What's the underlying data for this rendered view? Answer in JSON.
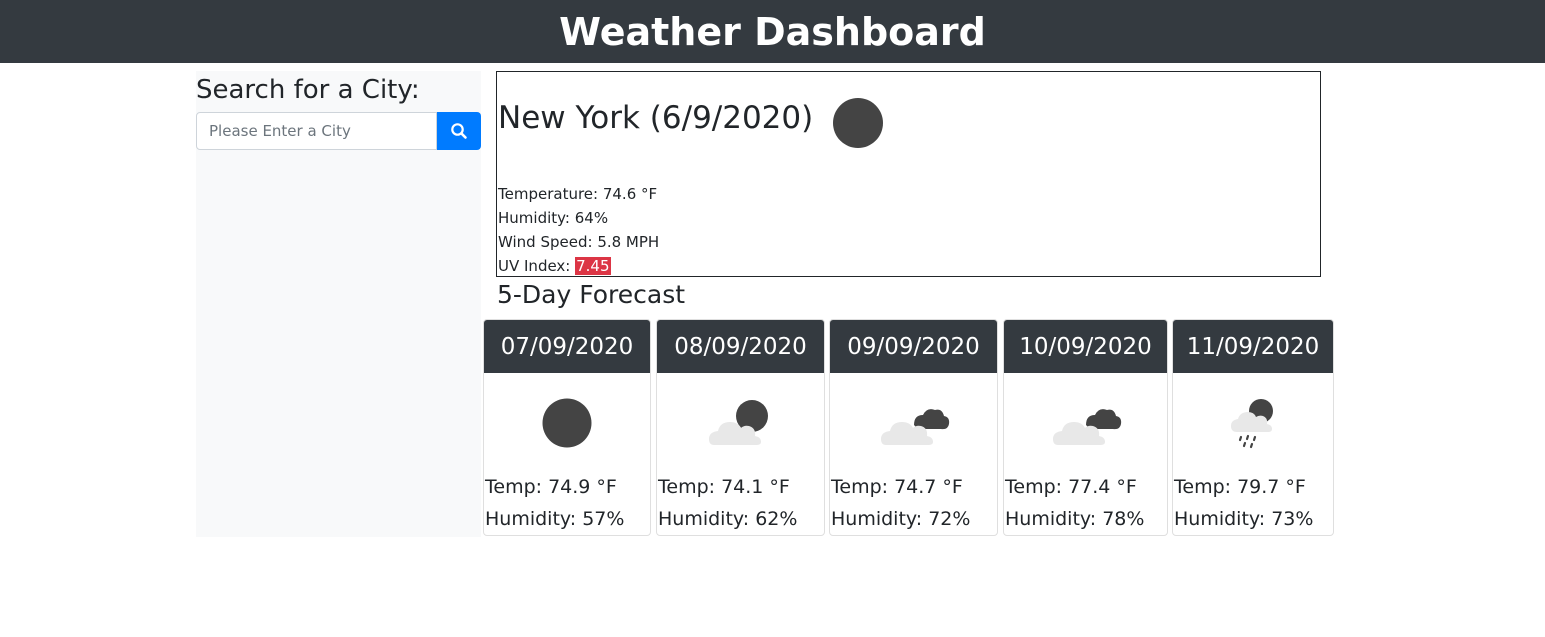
{
  "header": {
    "title": "Weather Dashboard"
  },
  "search": {
    "heading": "Search for a City:",
    "placeholder": "Please Enter a City",
    "value": "",
    "button_icon": "search-icon",
    "button_color": "#007bff"
  },
  "current": {
    "title": "New York (6/9/2020)",
    "icon": "clear-sun-icon",
    "temperature_label": "Temperature: ",
    "temperature": "74.6 °F",
    "humidity_label": "Humidity: ",
    "humidity": "64%",
    "wind_label": "Wind Speed: ",
    "wind": "5.8 MPH",
    "uv_label": "UV Index: ",
    "uv": "7.45",
    "uv_color": "#dc3545"
  },
  "forecast": {
    "title": "5-Day Forecast",
    "days": [
      {
        "date": "07/09/2020",
        "icon": "clear-sun-icon",
        "temp": "Temp: 74.9 °F",
        "humidity": "Humidity: 57%"
      },
      {
        "date": "08/09/2020",
        "icon": "partly-cloudy-icon",
        "temp": "Temp: 74.1 °F",
        "humidity": "Humidity: 62%"
      },
      {
        "date": "09/09/2020",
        "icon": "broken-clouds-icon",
        "temp": "Temp: 74.7 °F",
        "humidity": "Humidity: 72%"
      },
      {
        "date": "10/09/2020",
        "icon": "broken-clouds-icon",
        "temp": "Temp: 77.4 °F",
        "humidity": "Humidity: 78%"
      },
      {
        "date": "11/09/2020",
        "icon": "rain-icon",
        "temp": "Temp: 79.7 °F",
        "humidity": "Humidity: 73%"
      }
    ]
  },
  "colors": {
    "header_bg": "#343a40",
    "sidebar_bg": "#f8f9fa"
  }
}
